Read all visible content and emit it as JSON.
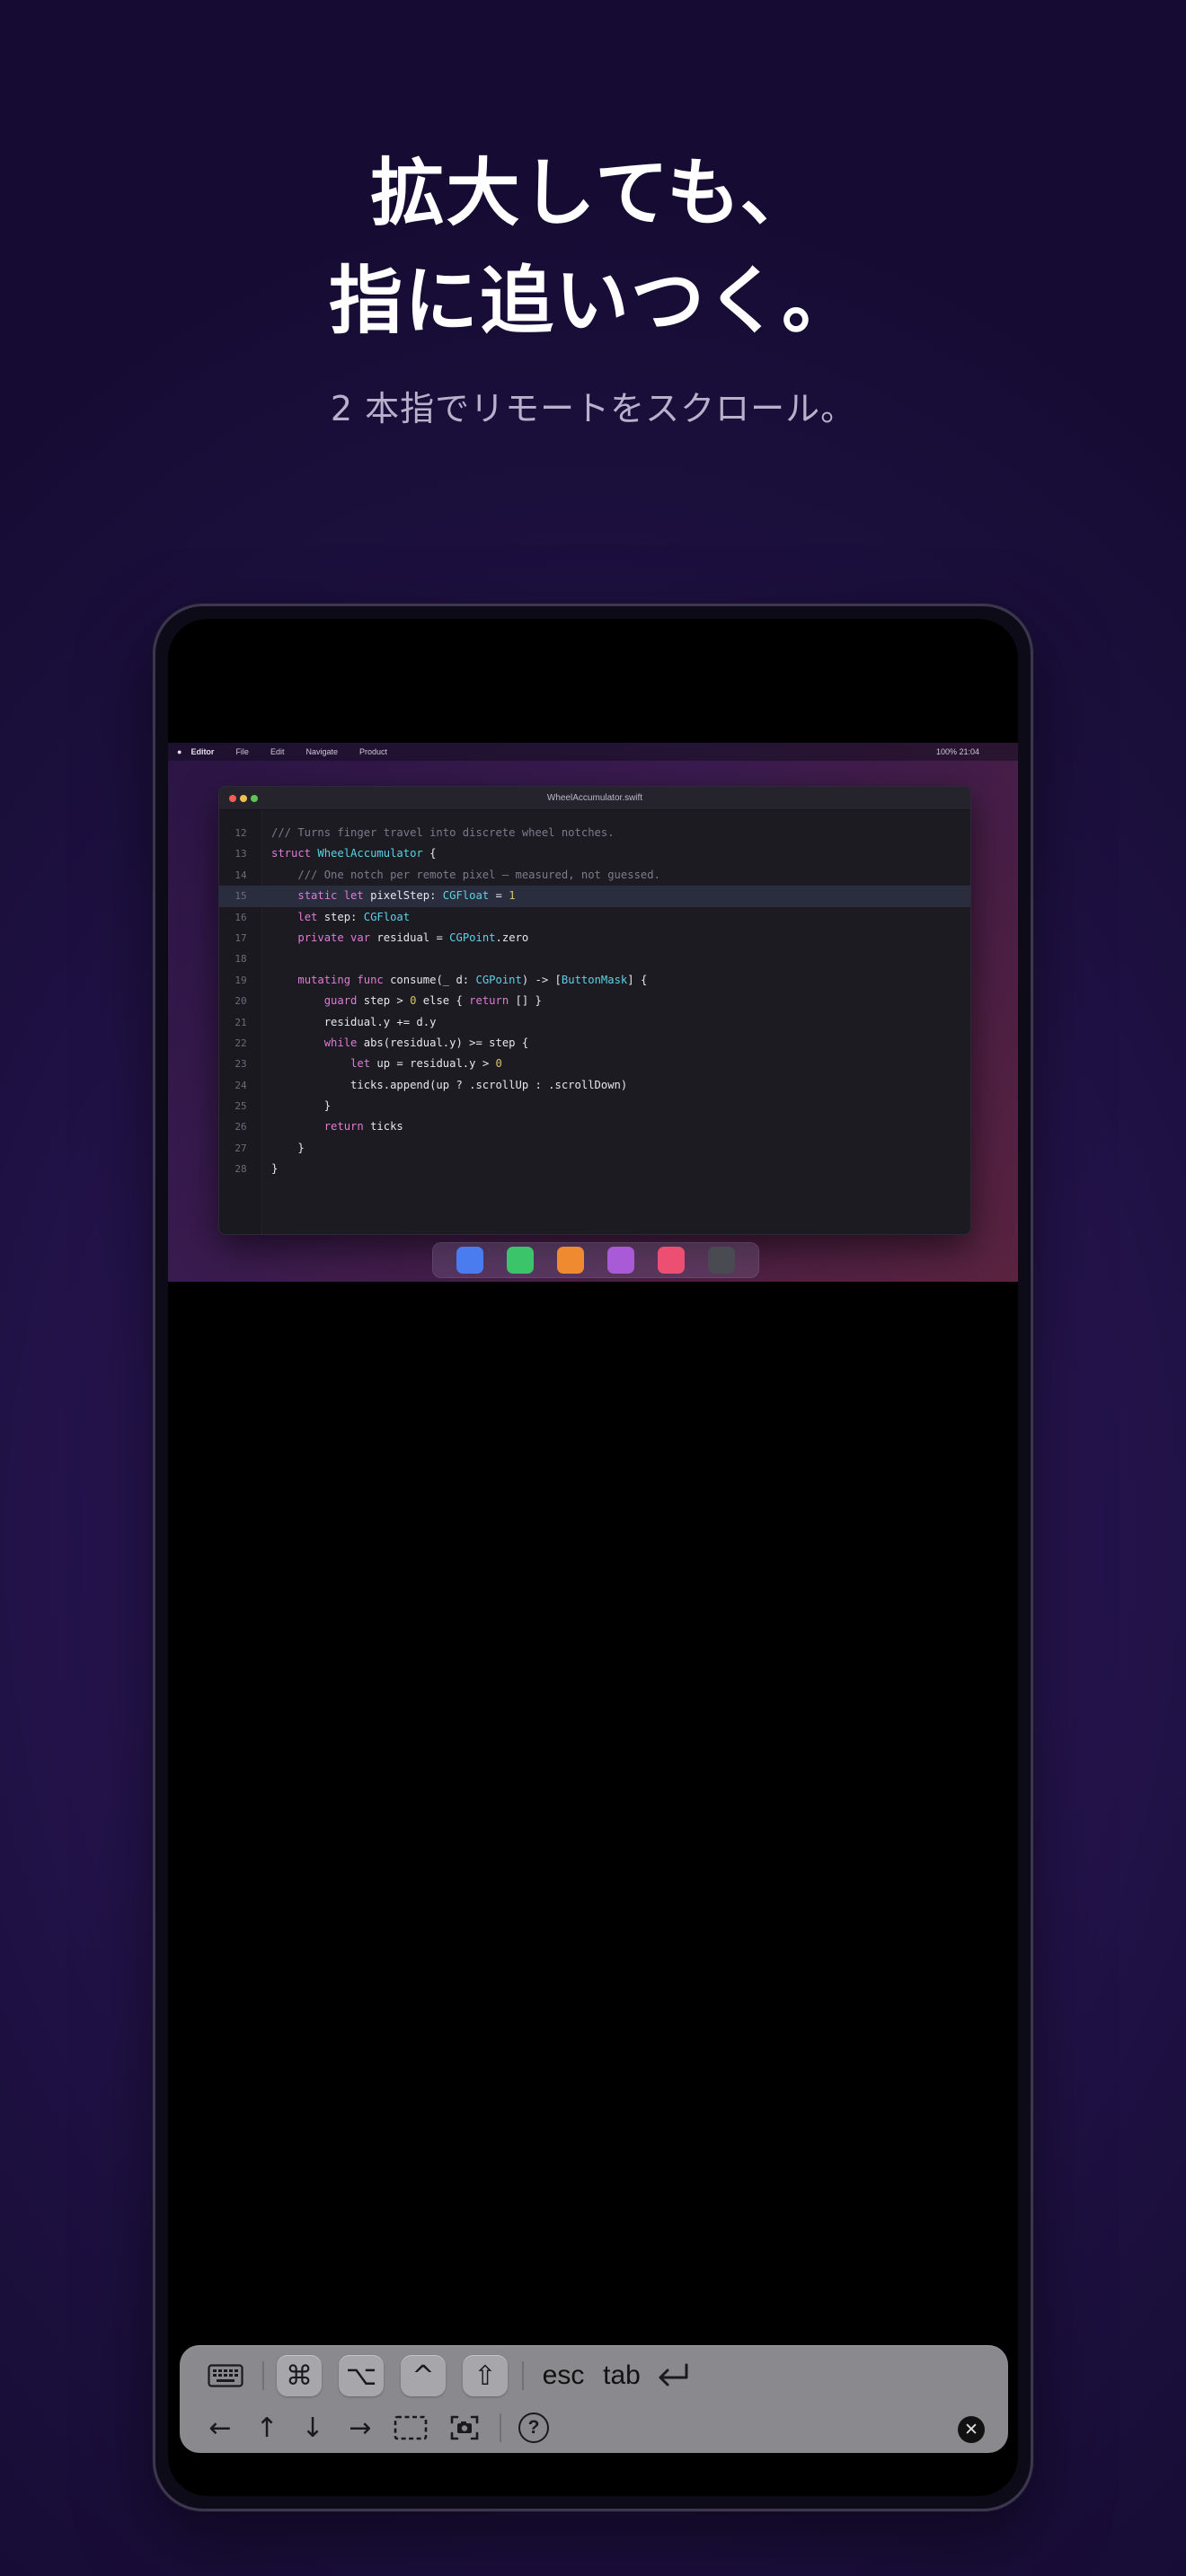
{
  "headline": {
    "line1": "拡大しても、",
    "line2": "指に追いつく。"
  },
  "subline": "2 本指でリモートをスクロール。",
  "menubar": {
    "app_name": "Editor",
    "items": [
      "File",
      "Edit",
      "Navigate",
      "Product"
    ],
    "status": "100%  21:04"
  },
  "window": {
    "title": "WheelAccumulator.swift"
  },
  "code_lines": [
    {
      "n": "12",
      "html": "<span class=\"c\">/// Turns finger travel into discrete wheel notches.</span>"
    },
    {
      "n": "13",
      "html": "<span class=\"k\">struct</span> <span class=\"t\">WheelAccumulator</span> {"
    },
    {
      "n": "14",
      "html": "    <span class=\"c\">/// One notch per remote pixel — measured, not guessed.</span>"
    },
    {
      "n": "15",
      "html": "    <span class=\"k\">static let</span> pixelStep: <span class=\"t\">CGFloat</span> = <span class=\"n\">1</span>",
      "hl": true
    },
    {
      "n": "16",
      "html": "    <span class=\"k\">let</span> step: <span class=\"t\">CGFloat</span>"
    },
    {
      "n": "17",
      "html": "    <span class=\"k\">private var</span> residual = <span class=\"t\">CGPoint</span>.zero"
    },
    {
      "n": "18",
      "html": ""
    },
    {
      "n": "19",
      "html": "    <span class=\"k\">mutating func</span> consume(_ d: <span class=\"t\">CGPoint</span>) -> [<span class=\"t\">ButtonMask</span>] {"
    },
    {
      "n": "20",
      "html": "        <span class=\"k\">guard</span> step > <span class=\"n\">0</span> else { <span class=\"k\">return</span> [] }"
    },
    {
      "n": "21",
      "html": "        residual.y += d.y"
    },
    {
      "n": "22",
      "html": "        <span class=\"k\">while</span> abs(residual.y) >= step {"
    },
    {
      "n": "23",
      "html": "            <span class=\"k\">let</span> up = residual.y > <span class=\"n\">0</span>"
    },
    {
      "n": "24",
      "html": "            ticks.append(up ? .scrollUp : .scrollDown)"
    },
    {
      "n": "25",
      "html": "        }"
    },
    {
      "n": "26",
      "html": "        <span class=\"k\">return</span> ticks"
    },
    {
      "n": "27",
      "html": "    }"
    },
    {
      "n": "28",
      "html": "}"
    }
  ],
  "dock_apps": [
    {
      "name": "app-blue",
      "color": "#4a7cf0"
    },
    {
      "name": "app-green",
      "color": "#3cc46a"
    },
    {
      "name": "app-orange",
      "color": "#f08a30"
    },
    {
      "name": "app-purple",
      "color": "#a95ad6"
    },
    {
      "name": "app-pink",
      "color": "#ec4f72"
    },
    {
      "name": "app-gray",
      "color": "#4a4a52"
    }
  ],
  "keyboard_bar": {
    "keys": {
      "command": "⌘",
      "option": "⌥",
      "control": "^",
      "shift": "⇧",
      "esc": "esc",
      "tab": "tab",
      "return": "⏎",
      "left": "←",
      "up": "↑",
      "down": "↓",
      "right": "→",
      "help": "?",
      "close": "✕"
    }
  }
}
